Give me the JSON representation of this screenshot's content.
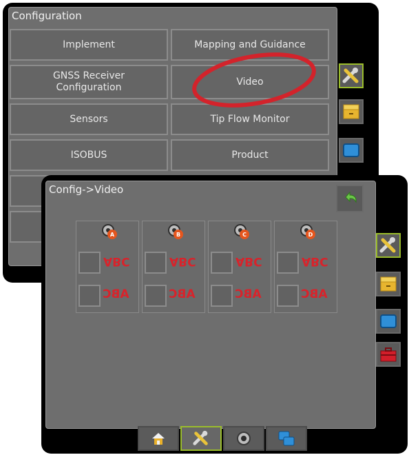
{
  "config_screen": {
    "title": "Configuration",
    "buttons": [
      {
        "label": "Implement"
      },
      {
        "label": "Mapping and Guidance"
      },
      {
        "label": "GNSS Receiver\nConfiguration"
      },
      {
        "label": "Video"
      },
      {
        "label": "Sensors"
      },
      {
        "label": "Tip Flow Monitor"
      },
      {
        "label": "ISOBUS"
      },
      {
        "label": "Product"
      }
    ],
    "side_icons": [
      "tools-icon",
      "file-cabinet-icon",
      "blue-screen-icon"
    ]
  },
  "video_screen": {
    "title": "Config->Video",
    "back_icon": "back-arrow-icon",
    "cameras": [
      {
        "badge": "A",
        "row1": "ABC",
        "row2": "ABC"
      },
      {
        "badge": "B",
        "row1": "ABC",
        "row2": "ABC"
      },
      {
        "badge": "C",
        "row1": "ABC",
        "row2": "ABC"
      },
      {
        "badge": "D",
        "row1": "ABC",
        "row2": "ABC"
      }
    ],
    "side_icons": [
      "tools-icon",
      "file-cabinet-icon",
      "blue-screen-icon",
      "toolbox-icon"
    ],
    "bottom_tabs": [
      "home-icon",
      "tools-icon",
      "camera-icon",
      "blue-screens-icon"
    ]
  },
  "colors": {
    "highlight_circle": "#d3232b",
    "accent_green": "#9bbd2b",
    "mirror_text": "#d8232b"
  }
}
